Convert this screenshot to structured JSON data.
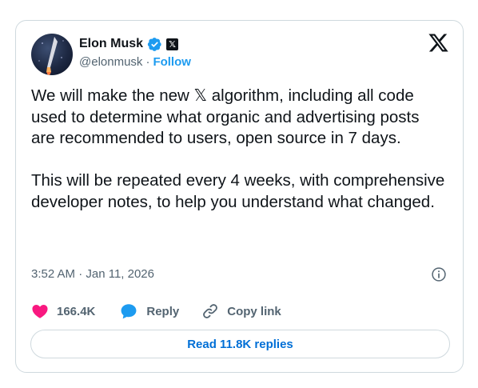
{
  "author": {
    "name": "Elon Musk",
    "handle": "@elonmusk",
    "separator": "·",
    "follow_label": "Follow",
    "badge_glyph": "𝕏"
  },
  "tweet": {
    "text": "We will make the new 𝕏 algorithm, including all code used to determine what organic and advertising posts are recommended to users, open source in 7 days.\n\nThis will be repeated every 4 weeks, with comprehensive developer notes, to help you understand what changed.",
    "timestamp": "3:52 AM · Jan 11, 2026"
  },
  "actions": {
    "like_count": "166.4K",
    "reply_label": "Reply",
    "copy_link_label": "Copy link"
  },
  "read_replies_label": "Read 11.8K replies",
  "icons": [
    "verified-icon",
    "x-badge-icon",
    "x-logo-icon",
    "info-icon",
    "heart-icon",
    "reply-icon",
    "link-icon"
  ],
  "colors": {
    "accent": "#1d9bf0",
    "replies_link": "#006fd6",
    "heart": "#f91880",
    "text_primary": "#0f1419",
    "text_secondary": "#536471",
    "border": "#cfd9de"
  }
}
